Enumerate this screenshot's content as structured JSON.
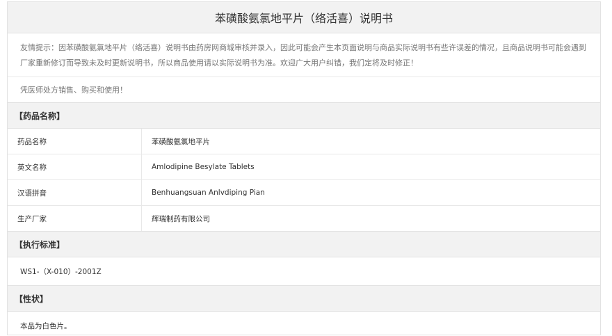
{
  "title": "苯磺酸氨氯地平片（络活喜）说明书",
  "notice": "友情提示：因苯磺酸氨氯地平片（络活喜）说明书由药房网商城审核并录入，因此可能会产生本页面说明与商品实际说明书有些许误差的情况，且商品说明书可能会遇到厂家重新修订而导致未及时更新说明书，所以商品使用请以实际说明书为准。欢迎广大用户纠错，我们定将及时修正！",
  "rx_note": "凭医师处方销售、购买和使用！",
  "sections": {
    "drug_name": {
      "heading": "【药品名称】",
      "rows": [
        {
          "label": "药品名称",
          "value": "苯磺酸氨氯地平片"
        },
        {
          "label": "英文名称",
          "value": "Amlodipine Besylate Tablets"
        },
        {
          "label": "汉语拼音",
          "value": "Benhuangsuan Anlvdiping Pian"
        },
        {
          "label": "生产厂家",
          "value": "辉瑞制药有限公司"
        }
      ]
    },
    "standard": {
      "heading": "【执行标准】",
      "text": "WS1-（X-010）-2001Z"
    },
    "appearance": {
      "heading": "【性状】",
      "text": "本品为白色片。"
    }
  }
}
